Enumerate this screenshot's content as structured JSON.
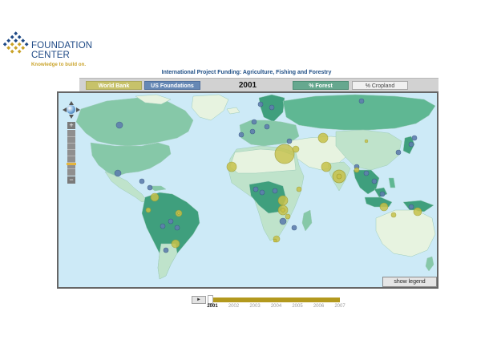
{
  "logo": {
    "line1": "FOUNDATION",
    "line2": "CENTER",
    "tagline": "Knowledge to build on.",
    "colors": {
      "primary": "#1f4a86",
      "accent": "#c9a227"
    }
  },
  "title": "International Project Funding: Agriculture, Fishing and Forestry",
  "toolbar": {
    "world_bank": "World Bank",
    "us_foundations": "US Foundations",
    "year": "2001",
    "forest": "% Forest",
    "cropland": "% Cropland",
    "colors": {
      "world_bank": "#c7c26a",
      "us_foundations": "#6688b5",
      "forest": "#66a88f",
      "cropland": "#f0f0f0"
    }
  },
  "map": {
    "layer": "% Forest",
    "colors": {
      "ocean": "#cdeaf7",
      "forest_high": "#3f9f7d",
      "forest_mid": "#5fb793",
      "forest_low": "#86c8a8",
      "forest_sparse": "#bfe3cb",
      "no_forest": "#e7f3e0",
      "world_bank_marker": "#c7c24a",
      "us_foundation_marker": "#5f7fae"
    },
    "nav": {
      "zoom_in": "+",
      "zoom_out": "−",
      "pan_icon": "globe-icon",
      "zoom_level": 0.75
    },
    "show_legend": "show legend"
  },
  "timeline": {
    "play_icon": "play-icon",
    "play_glyph": "►",
    "selected_year": "2001",
    "years": [
      "2001",
      "2002",
      "2003",
      "2004",
      "2005",
      "2006",
      "2007"
    ]
  }
}
